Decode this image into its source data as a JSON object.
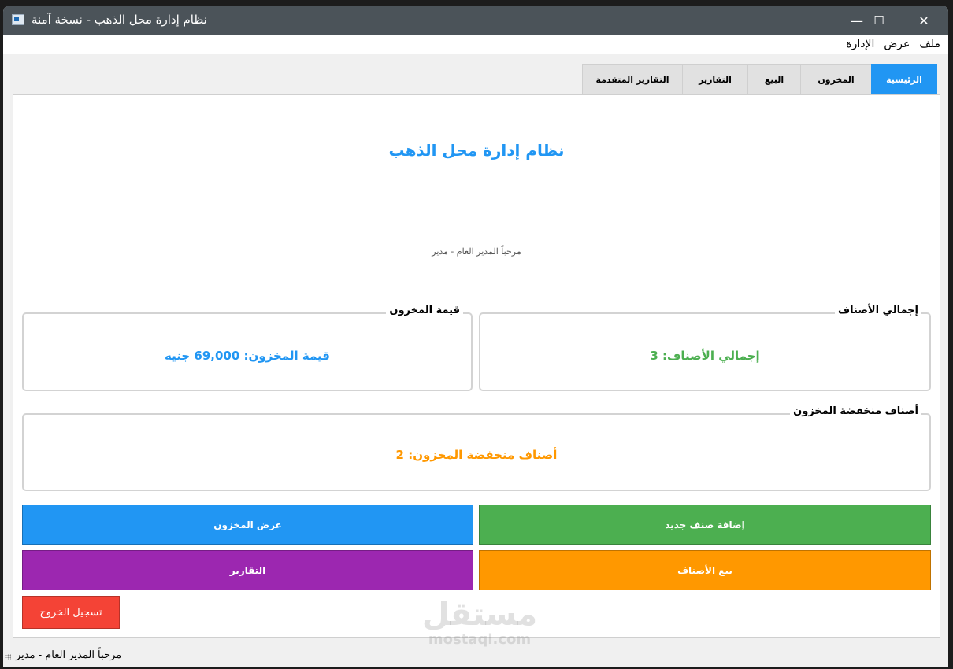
{
  "window": {
    "title": "نظام إدارة محل الذهب - نسخة آمنة",
    "minimize_glyph": "—",
    "maximize_glyph": "☐",
    "close_glyph": "✕"
  },
  "menubar": {
    "items": [
      "ملف",
      "عرض",
      "الإدارة"
    ]
  },
  "tabs": [
    {
      "label": "الرئيسية",
      "active": true
    },
    {
      "label": "المخزون",
      "active": false
    },
    {
      "label": "البيع",
      "active": false
    },
    {
      "label": "التقارير",
      "active": false
    },
    {
      "label": "التقارير المتقدمة",
      "active": false
    }
  ],
  "home": {
    "heading": "نظام إدارة محل الذهب",
    "welcome": "مرحباً المدير العام - مدير",
    "total_items": {
      "title": "إجمالي الأصناف",
      "value": "إجمالي الأصناف: 3",
      "color": "#4caf50"
    },
    "inventory_value": {
      "title": "قيمة المخزون",
      "value": "قيمة المخزون: 69,000 جنيه",
      "color": "#2196f3"
    },
    "low_stock": {
      "title": "أصناف منخفضة المخزون",
      "value": "أصناف منخفضة المخزون: 2",
      "color": "#ff9800"
    }
  },
  "actions": {
    "add_item": {
      "label": "إضافة صنف جديد",
      "color": "#4caf50"
    },
    "view_inventory": {
      "label": "عرض المخزون",
      "color": "#2196f3"
    },
    "sell_items": {
      "label": "بيع الأصناف",
      "color": "#ff9800"
    },
    "reports": {
      "label": "التقارير",
      "color": "#9c27b0"
    },
    "logout": {
      "label": "تسجيل الخروج",
      "color": "#f44336"
    }
  },
  "statusbar": {
    "text": "مرحباً المدير العام - مدير"
  },
  "watermark": {
    "arabic": "مستقل",
    "latin": "mostaql.com"
  }
}
